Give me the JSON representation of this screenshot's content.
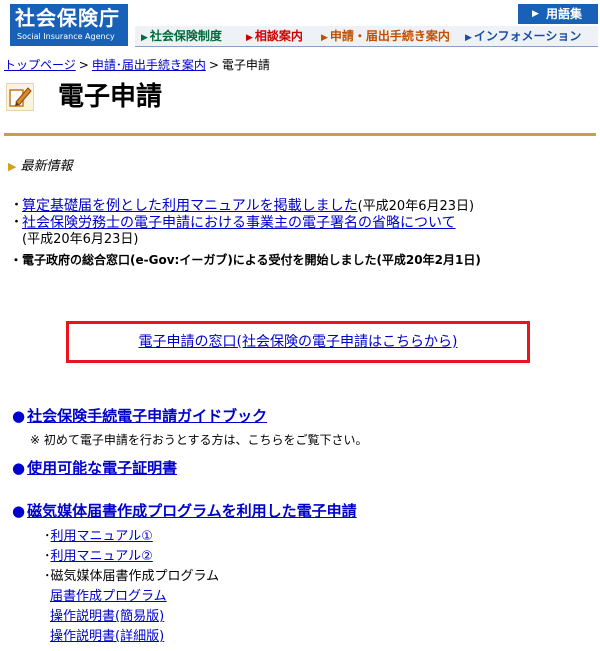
{
  "header": {
    "logo_jp": "社会保険庁",
    "logo_en": "Social Insurance Agency",
    "glossary_label": "用語集",
    "nav": [
      {
        "label": "社会保険制度"
      },
      {
        "label": "相談案内"
      },
      {
        "label": "申請・届出手続き案内"
      },
      {
        "label": "インフォメーション"
      }
    ]
  },
  "breadcrumb": {
    "top": "トップページ",
    "parent": "申請･届出手続き案内",
    "current": "電子申請"
  },
  "page_title": "電子申請",
  "news": {
    "heading": "最新情報",
    "items": [
      {
        "bullet": "・",
        "link": "算定基礎届を例とした利用マニュアルを掲載しました",
        "date": "(平成20年6月23日)"
      },
      {
        "bullet": "・",
        "link": "社会保険労務士の電子申請における事業主の電子署名の省略について",
        "date": "(平成20年6月23日)"
      },
      {
        "bullet": "・",
        "text": "電子政府の総合窓口(e-Gov:イーガブ)による受付を開始しました(平成20年2月1日)"
      }
    ]
  },
  "portal_link": "電子申請の窓口(社会保険の電子申請はこちらから)",
  "sections": [
    {
      "dot": "●",
      "label": "社会保険手続電子申請ガイドブック",
      "note": "※ 初めて電子申請を行おうとする方は、こちらをご覧下さい。"
    },
    {
      "dot": "●",
      "label": "使用可能な電子証明書"
    },
    {
      "dot": "●",
      "label": "磁気媒体届書作成プログラムを利用した電子申請"
    }
  ],
  "magnetic": {
    "manual1": "利用マニュアル①",
    "manual2": "利用マニュアル②",
    "program_heading": "磁気媒体届書作成プログラム",
    "program_link": "届書作成プログラム",
    "guide_simple": "操作説明書(簡易版)",
    "guide_detail": "操作説明書(詳細版)",
    "bullet": "･"
  },
  "colors": {
    "brand_blue": "#1761b8",
    "link": "#0000cc",
    "portal_border": "#e8141e",
    "title_rule": "#c8a040"
  }
}
